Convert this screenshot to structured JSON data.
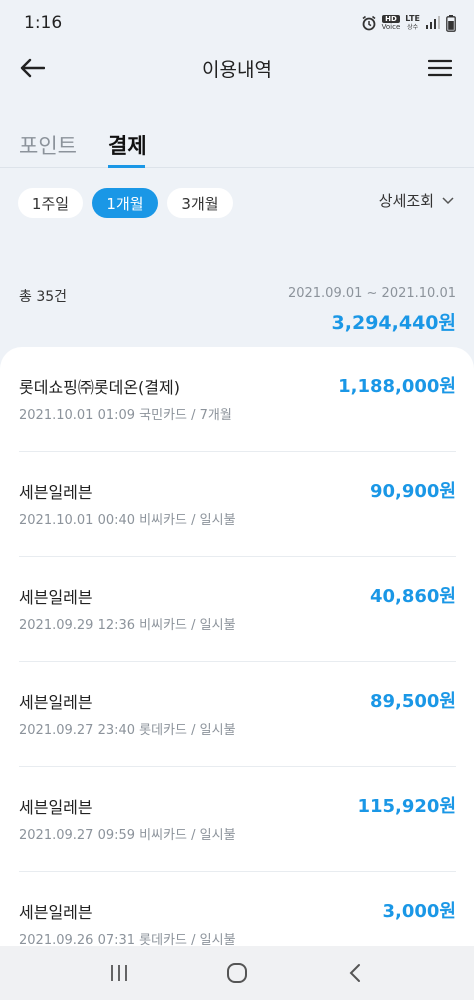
{
  "status": {
    "time": "1:16",
    "hd": "HD",
    "hd_sub": "Voice",
    "lte": "LTE",
    "lte_sub": "상수"
  },
  "header": {
    "title": "이용내역"
  },
  "tabs": [
    {
      "label": "포인트"
    },
    {
      "label": "결제"
    }
  ],
  "filters": {
    "chips": [
      {
        "label": "1주일"
      },
      {
        "label": "1개월"
      },
      {
        "label": "3개월"
      }
    ],
    "selected": "1개월",
    "detail_label": "상세조회"
  },
  "summary": {
    "count": "총 35건",
    "period": "2021.09.01 ~ 2021.10.01",
    "total": "3,294,440원"
  },
  "transactions": [
    {
      "merchant": "롯데쇼핑㈜롯데온(결제)",
      "amount": "1,188,000원",
      "meta": "2021.10.01  01:09  국민카드 / 7개월"
    },
    {
      "merchant": "세븐일레븐",
      "amount": "90,900원",
      "meta": "2021.10.01  00:40  비씨카드 / 일시불"
    },
    {
      "merchant": "세븐일레븐",
      "amount": "40,860원",
      "meta": "2021.09.29  12:36  비씨카드 / 일시불"
    },
    {
      "merchant": "세븐일레븐",
      "amount": "89,500원",
      "meta": "2021.09.27  23:40  롯데카드 / 일시불"
    },
    {
      "merchant": "세븐일레븐",
      "amount": "115,920원",
      "meta": "2021.09.27  09:59  비씨카드 / 일시불"
    },
    {
      "merchant": "세븐일레븐",
      "amount": "3,000원",
      "meta": "2021.09.26  07:31  롯데카드 / 일시불"
    }
  ],
  "colors": {
    "accent": "#1a97e6",
    "background": "#eef2f7",
    "muted_text": "#8c939b"
  },
  "icons": {
    "back": "arrow-left-icon",
    "menu": "hamburger-menu-icon",
    "detail": "chevron-down-icon",
    "nav_recent": "recent-apps-icon",
    "nav_home": "home-icon",
    "nav_back": "nav-back-icon"
  }
}
